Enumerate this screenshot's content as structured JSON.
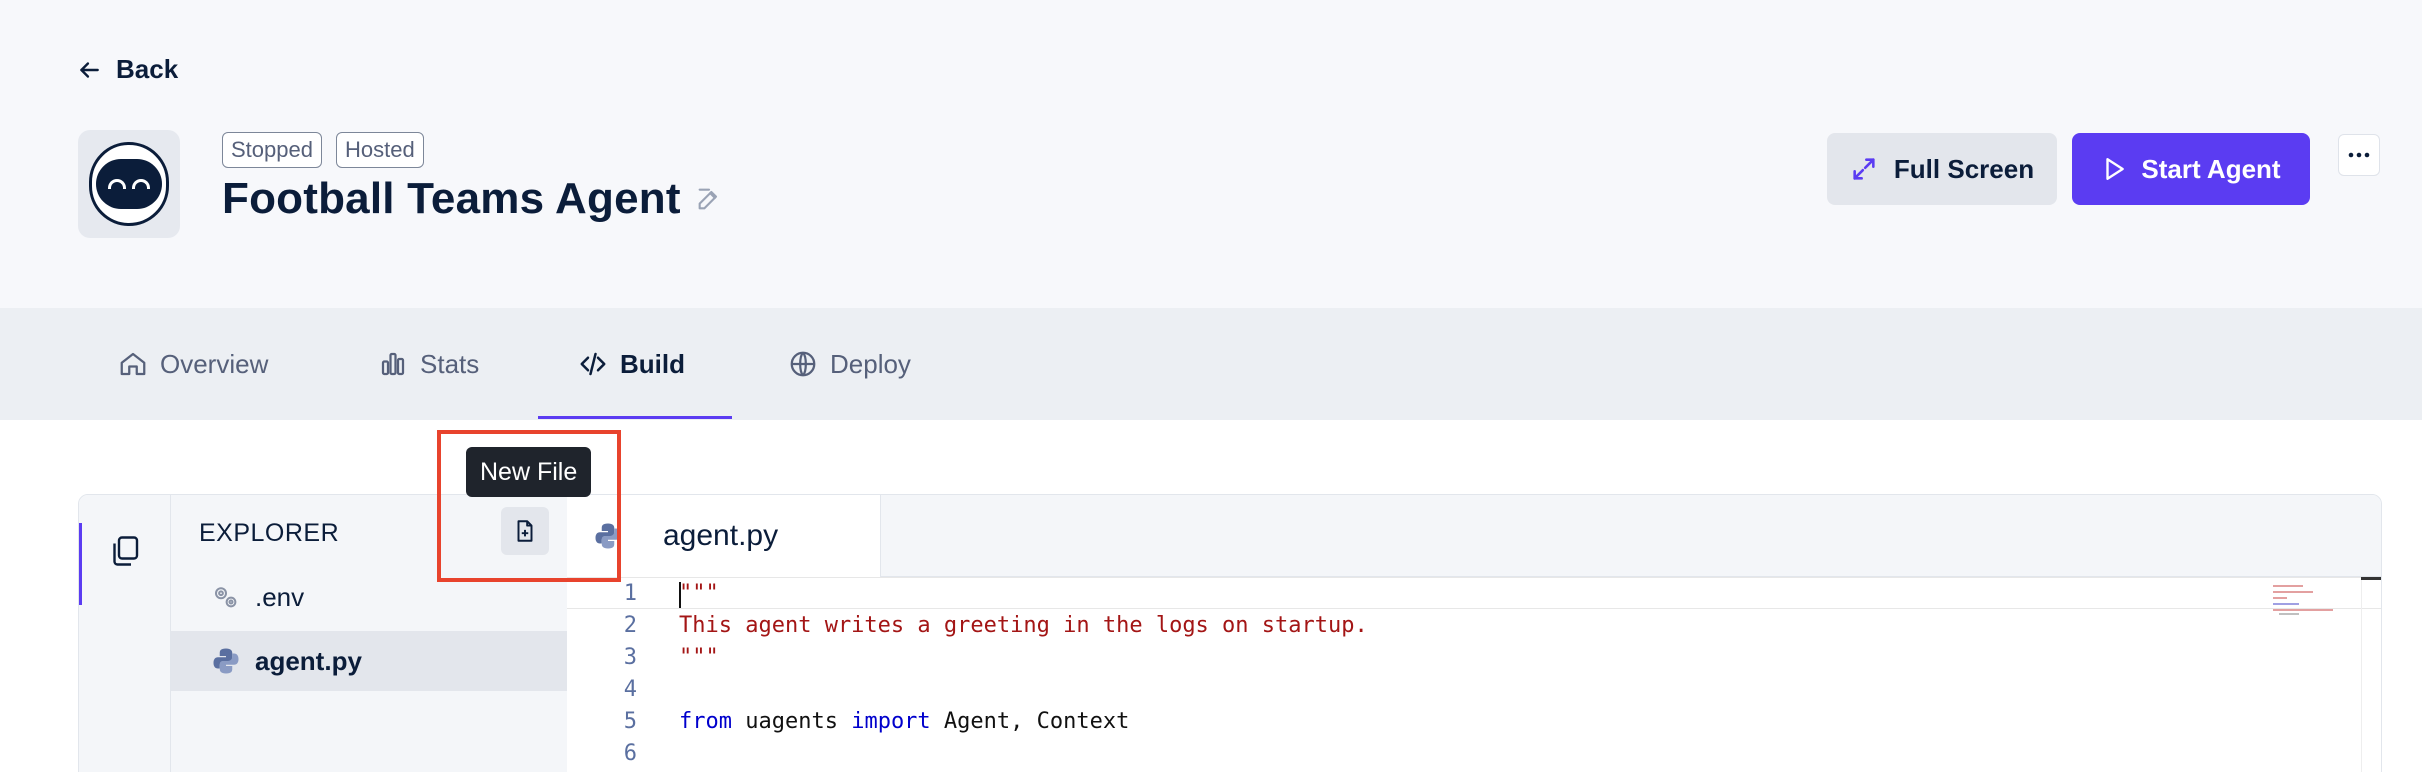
{
  "header": {
    "back_label": "Back",
    "badges": [
      "Stopped",
      "Hosted"
    ],
    "agent_name": "Football Teams Agent",
    "fullscreen_label": "Full Screen",
    "start_label": "Start Agent",
    "accent_color": "#5b3cf2"
  },
  "tabs": [
    {
      "label": "Overview",
      "icon": "home-icon"
    },
    {
      "label": "Stats",
      "icon": "bar-chart-icon"
    },
    {
      "label": "Build",
      "icon": "code-icon",
      "active": true
    },
    {
      "label": "Deploy",
      "icon": "globe-icon"
    }
  ],
  "explorer": {
    "title": "EXPLORER",
    "files": [
      {
        "name": ".env",
        "icon": "settings-file-icon"
      },
      {
        "name": "agent.py",
        "icon": "python-icon",
        "selected": true
      }
    ]
  },
  "tooltip": "New File",
  "editor": {
    "open_tab": "agent.py",
    "lines": [
      {
        "n": "1",
        "text": "\"\"\""
      },
      {
        "n": "2",
        "text": "This agent writes a greeting in the logs on startup."
      },
      {
        "n": "3",
        "text": "\"\"\""
      },
      {
        "n": "4",
        "text": ""
      },
      {
        "n": "5",
        "kw1": "from",
        "mod": " uagents ",
        "kw2": "import",
        "rest": " Agent, Context"
      },
      {
        "n": "6",
        "text": ""
      }
    ]
  }
}
